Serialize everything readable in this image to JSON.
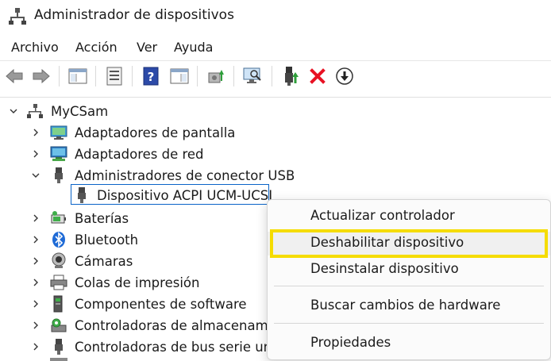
{
  "window": {
    "title": "Administrador de dispositivos"
  },
  "menu": [
    "Archivo",
    "Acción",
    "Ver",
    "Ayuda"
  ],
  "toolbar": {
    "buttons": [
      "back-arrow-icon",
      "forward-arrow-icon",
      "show-hide-console-tree-icon",
      "properties-icon",
      "help-icon",
      "action-pane-icon",
      "update-driver-icon",
      "scan-hardware-icon",
      "enable-device-icon",
      "uninstall-device-icon",
      "disable-device-icon"
    ]
  },
  "tree": {
    "root": "MyCSam",
    "items": [
      {
        "label": "Adaptadores de pantalla",
        "icon": "display-adapter-icon"
      },
      {
        "label": "Adaptadores de red",
        "icon": "network-adapter-icon"
      },
      {
        "label": "Administradores de conector USB",
        "icon": "usb-connector-icon",
        "expanded": true
      },
      {
        "label": "Dispositivo ACPI UCM-UCSI",
        "icon": "usb-connector-icon",
        "child": true,
        "selected": true
      },
      {
        "label": "Baterías",
        "icon": "battery-icon"
      },
      {
        "label": "Bluetooth",
        "icon": "bluetooth-icon"
      },
      {
        "label": "Cámaras",
        "icon": "camera-icon"
      },
      {
        "label": "Colas de impresión",
        "icon": "printer-icon"
      },
      {
        "label": "Componentes de software",
        "icon": "software-component-icon"
      },
      {
        "label": "Controladoras de almacenamie",
        "icon": "storage-controller-icon"
      },
      {
        "label": "Controladoras de bus serie univ",
        "icon": "usb-controller-icon"
      }
    ]
  },
  "context_menu": {
    "items": [
      "Actualizar controlador",
      "Deshabilitar dispositivo",
      "Desinstalar dispositivo",
      "Buscar cambios de hardware",
      "Propiedades"
    ],
    "highlighted": "Deshabilitar dispositivo"
  },
  "colors": {
    "highlight": "#f5dc00",
    "selection_border": "#0a64c8",
    "disable_red": "#e81123"
  }
}
